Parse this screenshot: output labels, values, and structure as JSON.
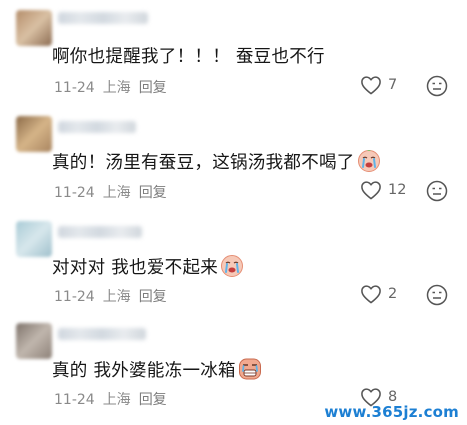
{
  "comments": [
    {
      "text": "啊你也提醒我了！！！ 蚕豆也不行",
      "date": "11-24",
      "location": "上海",
      "reply_label": "回复",
      "likes": "7",
      "avatar_color": "#c9a98a",
      "has_emoji": false
    },
    {
      "text": "真的！汤里有蚕豆，这锅汤我都不喝了",
      "date": "11-24",
      "location": "上海",
      "reply_label": "回复",
      "likes": "12",
      "avatar_color": "#b8946a",
      "has_emoji": true,
      "emoji_icon": "crying-face-icon"
    },
    {
      "text": "对对对 我也爱不起来",
      "date": "11-24",
      "location": "上海",
      "reply_label": "回复",
      "likes": "2",
      "avatar_color": "#b9d3dd",
      "has_emoji": true,
      "emoji_icon": "crying-face-icon"
    },
    {
      "text": "真的 我外婆能冻一冰箱",
      "date": "11-24",
      "location": "上海",
      "reply_label": "回复",
      "likes": "8",
      "avatar_color": "#9a8f86",
      "has_emoji": true,
      "emoji_icon": "tear-face-icon"
    }
  ],
  "watermark": "www.365jz.com"
}
